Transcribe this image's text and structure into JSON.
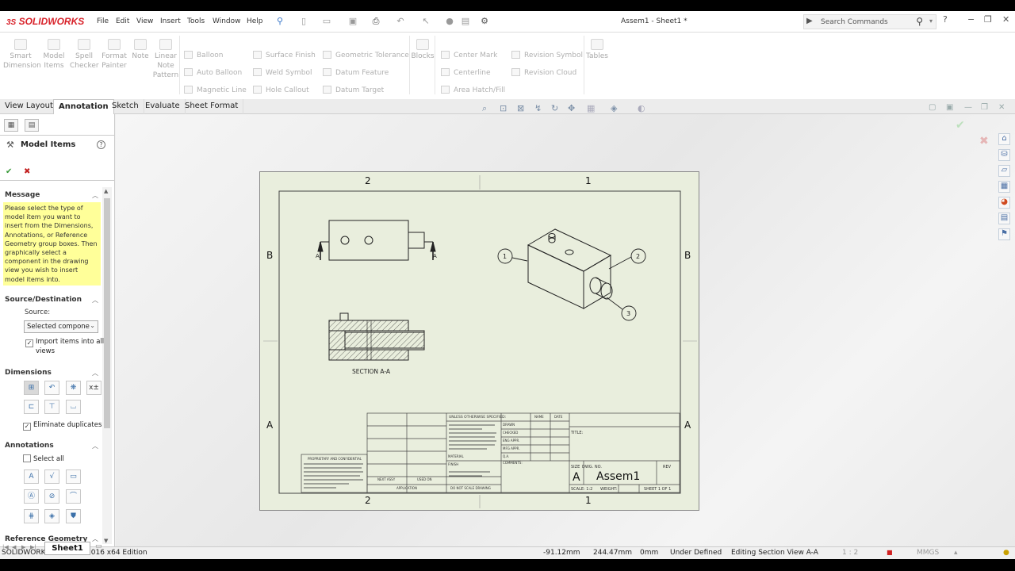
{
  "app": {
    "logo": "SOLIDWORKS",
    "doc_title": "Assem1 - Sheet1 *"
  },
  "menu": [
    "File",
    "Edit",
    "View",
    "Insert",
    "Tools",
    "Window",
    "Help"
  ],
  "search": {
    "placeholder": "Search Commands"
  },
  "window_controls": {
    "help": "?",
    "minimize": "−",
    "restore": "❐",
    "close": "✕"
  },
  "ribbon": {
    "smart_dimension": [
      "Smart",
      "Dimension"
    ],
    "model_items": [
      "Model",
      "Items"
    ],
    "spell_checker": [
      "Spell",
      "Checker"
    ],
    "format_painter": [
      "Format",
      "Painter"
    ],
    "note": "Note",
    "linear_note_pattern": [
      "Linear",
      "Note",
      "Pattern"
    ],
    "col1": [
      "Balloon",
      "Auto Balloon",
      "Magnetic Line"
    ],
    "col2": [
      "Surface Finish",
      "Weld Symbol",
      "Hole Callout"
    ],
    "col3": [
      "Geometric Tolerance",
      "Datum Feature",
      "Datum Target"
    ],
    "blocks": "Blocks",
    "col4": [
      "Center Mark",
      "Centerline",
      "Area Hatch/Fill"
    ],
    "col5": [
      "Revision Symbol",
      "Revision Cloud"
    ],
    "tables": "Tables"
  },
  "tabs": [
    "View Layout",
    "Annotation",
    "Sketch",
    "Evaluate",
    "Sheet Format"
  ],
  "panel": {
    "title": "Model Items",
    "ok": "✔",
    "cancel": "✖",
    "message_header": "Message",
    "message": "Please select the type of model item you want to insert from the Dimensions, Annotations, or Reference Geometry group boxes. Then graphically select a component in the drawing view you wish to insert model items into.",
    "source_header": "Source/Destination",
    "source_label": "Source:",
    "source_value": "Selected compone",
    "import_label": [
      "Import items into all",
      "views"
    ],
    "dimensions_header": "Dimensions",
    "eliminate_duplicates": "Eliminate duplicates",
    "annotations_header": "Annotations",
    "select_all": "Select all",
    "reference_geometry_header": "Reference Geometry"
  },
  "drawing": {
    "zone_top": [
      "2",
      "1"
    ],
    "zone_side": [
      "B",
      "A"
    ],
    "section_label": "SECTION A-A",
    "section_arrow_letter": "A",
    "balloons": [
      "1",
      "2",
      "3"
    ],
    "title_block": {
      "size_label": "SIZE",
      "dwg_no_label": "DWG. NO.",
      "rev_label": "REV",
      "size": "A",
      "dwg_no": "Assem1",
      "scale": "SCALE: 1:2",
      "weight": "WEIGHT:",
      "sheet": "SHEET 1 OF 1",
      "title_label": "TITLE:",
      "unless": "UNLESS OTHERWISE SPECIFIED:",
      "name": "NAME",
      "date": "DATE",
      "drawn": "DRAWN",
      "checked": "CHECKED",
      "eng_appr": "ENG APPR.",
      "mfg_appr": "MFG APPR.",
      "qa": "Q.A.",
      "comments": "COMMENTS:",
      "prop": "PROPRIETARY AND CONFIDENTIAL",
      "next_assy": "NEXT ASSY",
      "used_on": "USED ON",
      "application": "APPLICATION",
      "do_not_scale": "DO NOT SCALE DRAWING",
      "finish": "FINISH",
      "material": "MATERIAL"
    }
  },
  "sheet_tab": "Sheet1",
  "status": {
    "edition": "SOLIDWORKS Premium 2016 x64 Edition",
    "x": "-91.12mm",
    "y": "244.47mm",
    "z": "0mm",
    "state": "Under Defined",
    "editing": "Editing Section View A-A",
    "scale": "1 : 2",
    "units": "MMGS"
  }
}
